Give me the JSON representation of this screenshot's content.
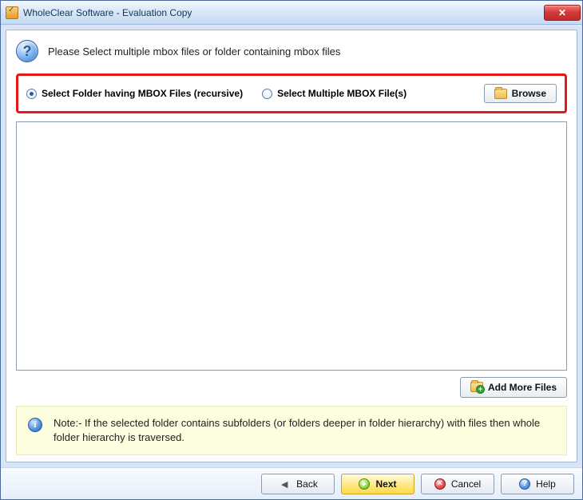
{
  "window": {
    "title": "WholeClear Software - Evaluation Copy",
    "close_glyph": "✕"
  },
  "prompt": {
    "help_glyph": "?",
    "text": "Please Select multiple mbox files or folder containing mbox files"
  },
  "selection": {
    "folder_label": "Select Folder having MBOX Files (recursive)",
    "files_label": "Select Multiple MBOX File(s)",
    "browse_label": "Browse"
  },
  "add_more": {
    "label": "Add More Files"
  },
  "note": {
    "info_glyph": "i",
    "text": "Note:- If the selected folder contains subfolders (or folders deeper in folder hierarchy) with files then whole folder hierarchy is traversed."
  },
  "footer": {
    "back": "Back",
    "next": "Next",
    "cancel": "Cancel",
    "help": "Help",
    "back_glyph": "◄",
    "cancel_glyph": "✕",
    "help_glyph": "?"
  }
}
